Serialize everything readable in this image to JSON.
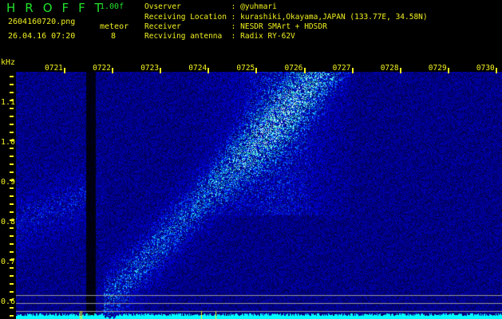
{
  "header": {
    "title": "HROFFT",
    "version": "1.00f",
    "filename": "2604160720.png",
    "datetime": "26.04.16 07:20",
    "meteor_label": "meteor",
    "meteor_count": "8"
  },
  "info": [
    {
      "label": "Ovserver           ",
      "value": "@yuhmari"
    },
    {
      "label": "Receiving Location ",
      "value": "kurashiki,Okayama,JAPAN (133.77E, 34.58N)"
    },
    {
      "label": "Receiver           ",
      "value": "NESDR SMArt + HDSDR"
    },
    {
      "label": "Recviving antenna  ",
      "value": "Radix RY-62V"
    }
  ],
  "axis": {
    "y_unit": "kHz",
    "y_labels": [
      "1.1",
      "1.0",
      "0.9",
      "0.8",
      "0.7",
      "0.6"
    ],
    "x_labels": [
      "0721",
      "0722",
      "0723",
      "0724",
      "0725",
      "0726",
      "0727",
      "0728",
      "0729",
      "0730"
    ]
  },
  "colors": {
    "text_green": "#22e02a",
    "text_yellow": "#f0f020",
    "level": "#00ffff"
  }
}
